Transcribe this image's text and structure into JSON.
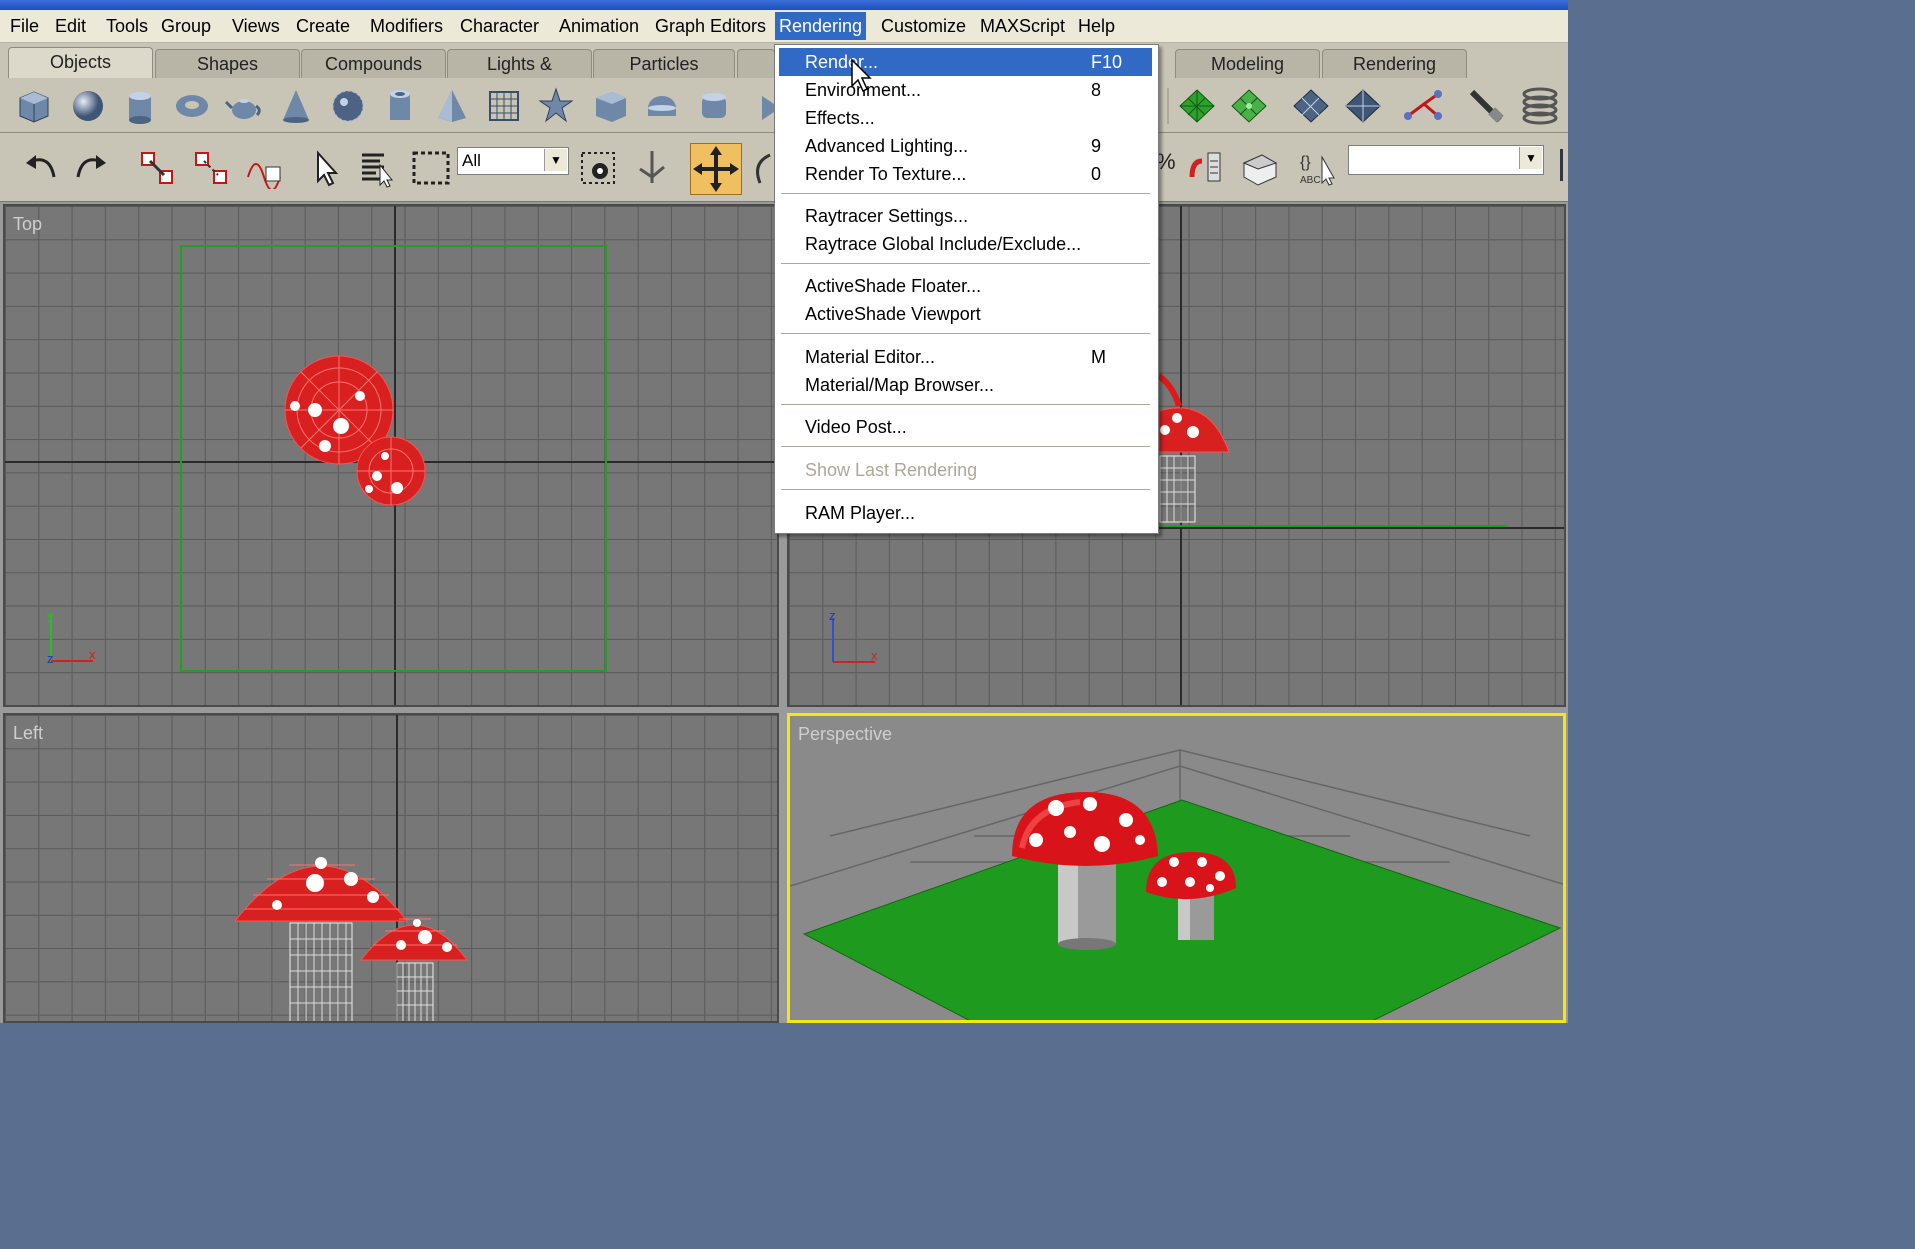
{
  "menubar": {
    "items": [
      {
        "label": "File"
      },
      {
        "label": "Edit"
      },
      {
        "label": "Tools"
      },
      {
        "label": "Group"
      },
      {
        "label": "Views"
      },
      {
        "label": "Create"
      },
      {
        "label": "Modifiers"
      },
      {
        "label": "Character"
      },
      {
        "label": "Animation"
      },
      {
        "label": "Graph Editors"
      },
      {
        "label": "Rendering"
      },
      {
        "label": "Customize"
      },
      {
        "label": "MAXScript"
      },
      {
        "label": "Help"
      }
    ]
  },
  "tabs": [
    {
      "label": "Objects"
    },
    {
      "label": "Shapes"
    },
    {
      "label": "Compounds"
    },
    {
      "label": "Lights & Cameras"
    },
    {
      "label": "Particles"
    },
    {
      "label": "Modeling"
    },
    {
      "label": "Rendering"
    }
  ],
  "toolbar": {
    "selection_filter": "All",
    "named_selection": ""
  },
  "viewports": {
    "top": "Top",
    "front": "",
    "left": "Left",
    "perspective": "Perspective"
  },
  "axes": {
    "x": "x",
    "y": "y",
    "z": "z"
  },
  "rendering_menu": {
    "items": [
      {
        "label": "Render...",
        "shortcut": "F10"
      },
      {
        "label": "Environment...",
        "shortcut": "8"
      },
      {
        "label": "Effects...",
        "shortcut": ""
      },
      {
        "label": "Advanced Lighting...",
        "shortcut": "9"
      },
      {
        "label": "Render To Texture...",
        "shortcut": "0"
      },
      {
        "label": "Raytracer Settings...",
        "shortcut": ""
      },
      {
        "label": "Raytrace Global Include/Exclude...",
        "shortcut": ""
      },
      {
        "label": "ActiveShade Floater...",
        "shortcut": ""
      },
      {
        "label": "ActiveShade Viewport",
        "shortcut": ""
      },
      {
        "label": "Material Editor...",
        "shortcut": "M"
      },
      {
        "label": "Material/Map Browser...",
        "shortcut": ""
      },
      {
        "label": "Video Post...",
        "shortcut": ""
      },
      {
        "label": "Show Last Rendering",
        "shortcut": ""
      },
      {
        "label": "RAM Player...",
        "shortcut": ""
      }
    ]
  },
  "colors": {
    "menu_highlight": "#316ac5",
    "active_viewport_border": "#f5e80c",
    "mushroom_red": "#e01010",
    "ground_green": "#1e9a1e"
  }
}
